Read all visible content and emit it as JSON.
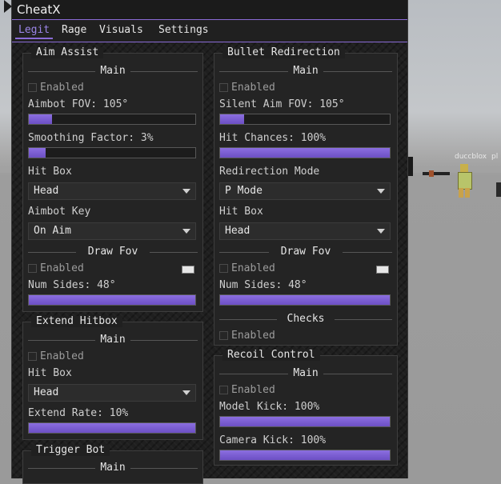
{
  "window": {
    "title": "CheatX"
  },
  "tabs": [
    {
      "label": "Legit",
      "active": true
    },
    {
      "label": "Rage",
      "active": false
    },
    {
      "label": "Visuals",
      "active": false
    },
    {
      "label": "Settings",
      "active": false
    }
  ],
  "aim_assist": {
    "title": "Aim Assist",
    "main_label": "Main",
    "enabled_label": "Enabled",
    "enabled": false,
    "fov_label": "Aimbot FOV: 105°",
    "fov_fill": 0.14,
    "smoothing_label": "Smoothing Factor: 3%",
    "smoothing_fill": 0.1,
    "hitbox_label": "Hit Box",
    "hitbox_value": "Head",
    "key_label": "Aimbot Key",
    "key_value": "On Aim",
    "draw_fov_label": "Draw Fov",
    "draw_fov_enabled_label": "Enabled",
    "sides_label": "Num Sides: 48°",
    "sides_fill": 1.0
  },
  "extend_hitbox": {
    "title": "Extend Hitbox",
    "main_label": "Main",
    "enabled_label": "Enabled",
    "hitbox_label": "Hit Box",
    "hitbox_value": "Head",
    "rate_label": "Extend Rate: 10%",
    "rate_fill": 1.0
  },
  "trigger_bot": {
    "title": "Trigger Bot",
    "main_label": "Main"
  },
  "bullet_redirection": {
    "title": "Bullet Redirection",
    "main_label": "Main",
    "enabled_label": "Enabled",
    "silent_fov_label": "Silent Aim FOV: 105°",
    "silent_fov_fill": 0.14,
    "hit_chance_label": "Hit Chances: 100%",
    "hit_chance_fill": 1.0,
    "mode_label": "Redirection Mode",
    "mode_value": "P Mode",
    "hitbox_label": "Hit Box",
    "hitbox_value": "Head",
    "draw_fov_label": "Draw Fov",
    "draw_fov_enabled_label": "Enabled",
    "sides_label": "Num Sides: 48°",
    "sides_fill": 1.0,
    "checks_label": "Checks",
    "checks_enabled_label": "Enabled"
  },
  "recoil_control": {
    "title": "Recoil Control",
    "main_label": "Main",
    "enabled_label": "Enabled",
    "model_kick_label": "Model Kick: 100%",
    "model_kick_fill": 1.0,
    "camera_kick_label": "Camera Kick: 100%",
    "camera_kick_fill": 1.0
  },
  "scene": {
    "player_names": [
      "duccblox",
      "pl"
    ]
  },
  "colors": {
    "accent": "#8a6bd6",
    "background": "#202020"
  }
}
